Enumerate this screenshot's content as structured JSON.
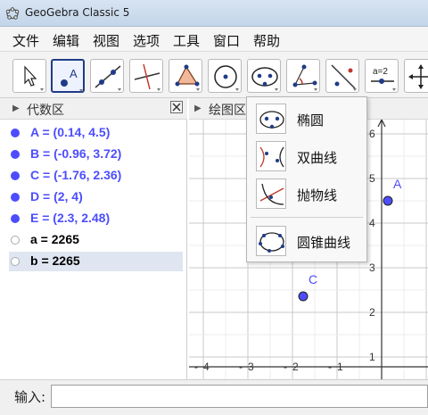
{
  "window": {
    "title": "GeoGebra Classic 5"
  },
  "menu": [
    "文件",
    "编辑",
    "视图",
    "选项",
    "工具",
    "窗口",
    "帮助"
  ],
  "toolbar": {
    "tools": [
      "move-tool",
      "point-tool",
      "line-tool",
      "perpendicular-line-tool",
      "polygon-tool",
      "circle-tool",
      "conic-tool",
      "angle-tool",
      "reflect-tool",
      "slider-tool",
      "move-graphics-tool"
    ],
    "slider_label": "a=2",
    "point_label": "A"
  },
  "algebra": {
    "title": "代数区",
    "items": [
      {
        "text": "A = (0.14, 4.5)",
        "color": "#4d4dff",
        "filled": true
      },
      {
        "text": "B = (-0.96, 3.72)",
        "color": "#4d4dff",
        "filled": true
      },
      {
        "text": "C = (-1.76, 2.36)",
        "color": "#4d4dff",
        "filled": true
      },
      {
        "text": "D = (2, 4)",
        "color": "#4d4dff",
        "filled": true
      },
      {
        "text": "E = (2.3, 2.48)",
        "color": "#4d4dff",
        "filled": true
      },
      {
        "text": "a = 2265",
        "color": "#000000",
        "filled": false
      },
      {
        "text": "b = 2265",
        "color": "#000000",
        "filled": false,
        "selected": true
      }
    ]
  },
  "graphics": {
    "title": "绘图区",
    "x_ticks": [
      "4",
      "3",
      "2",
      "1"
    ],
    "y_ticks": [
      "6",
      "5",
      "4",
      "3",
      "2",
      "1"
    ],
    "points": [
      {
        "label": "A",
        "x": 0.14,
        "y": 4.5
      },
      {
        "label": "C",
        "x": -1.76,
        "y": 2.36
      }
    ]
  },
  "dropdown": {
    "items": [
      "椭圆",
      "双曲线",
      "抛物线",
      "圆锥曲线"
    ]
  },
  "input": {
    "label": "输入:",
    "value": "",
    "placeholder": ""
  },
  "colors": {
    "point": "#4d4dff",
    "selection": "#1f3c88"
  }
}
